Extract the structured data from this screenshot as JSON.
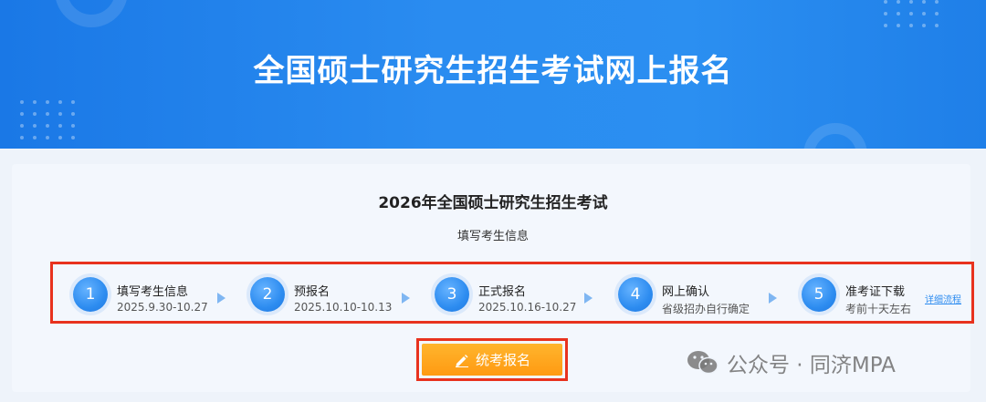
{
  "banner": {
    "title": "全国硕士研究生招生考试网上报名"
  },
  "main": {
    "exam_title": "2026年全国硕士研究生招生考试",
    "current_step": "填写考生信息"
  },
  "steps": [
    {
      "num": "1",
      "name": "填写考生信息",
      "date": "2025.9.30-10.27"
    },
    {
      "num": "2",
      "name": "预报名",
      "date": "2025.10.10-10.13"
    },
    {
      "num": "3",
      "name": "正式报名",
      "date": "2025.10.16-10.27"
    },
    {
      "num": "4",
      "name": "网上确认",
      "date": "省级招办自行确定"
    },
    {
      "num": "5",
      "name": "准考证下载",
      "date": "考前十天左右"
    }
  ],
  "detail_link": "详细流程",
  "apply_button": {
    "label": "统考报名",
    "icon": "pencil-icon"
  },
  "watermark": {
    "text": "公众号 · 同济MPA",
    "icon": "wechat-icon"
  },
  "colors": {
    "accent": "#2d8cf0",
    "button": "#ff9f15",
    "highlight_border": "#e8321e"
  }
}
